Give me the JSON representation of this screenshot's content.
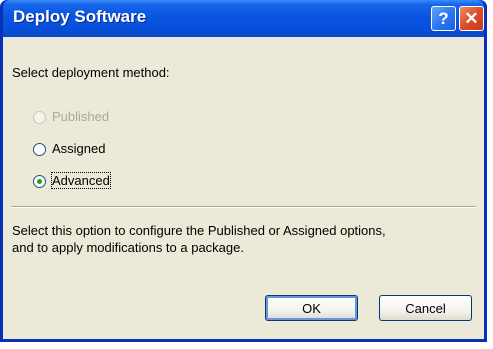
{
  "window": {
    "title": "Deploy Software",
    "help_glyph": "?",
    "close_glyph": "✕"
  },
  "dialog": {
    "prompt": "Select deployment method:",
    "options": [
      {
        "label": "Published",
        "enabled": false,
        "selected": false
      },
      {
        "label": "Assigned",
        "enabled": true,
        "selected": false
      },
      {
        "label": "Advanced",
        "enabled": true,
        "selected": true
      }
    ],
    "description_line1": "Select this option to configure the Published or Assigned options,",
    "description_line2": "and to apply modifications to a package.",
    "ok_label": "OK",
    "cancel_label": "Cancel"
  },
  "colors": {
    "title_bar": "#0a55df",
    "client_bg": "#ece9d8",
    "radio_dot": "#21a121"
  }
}
